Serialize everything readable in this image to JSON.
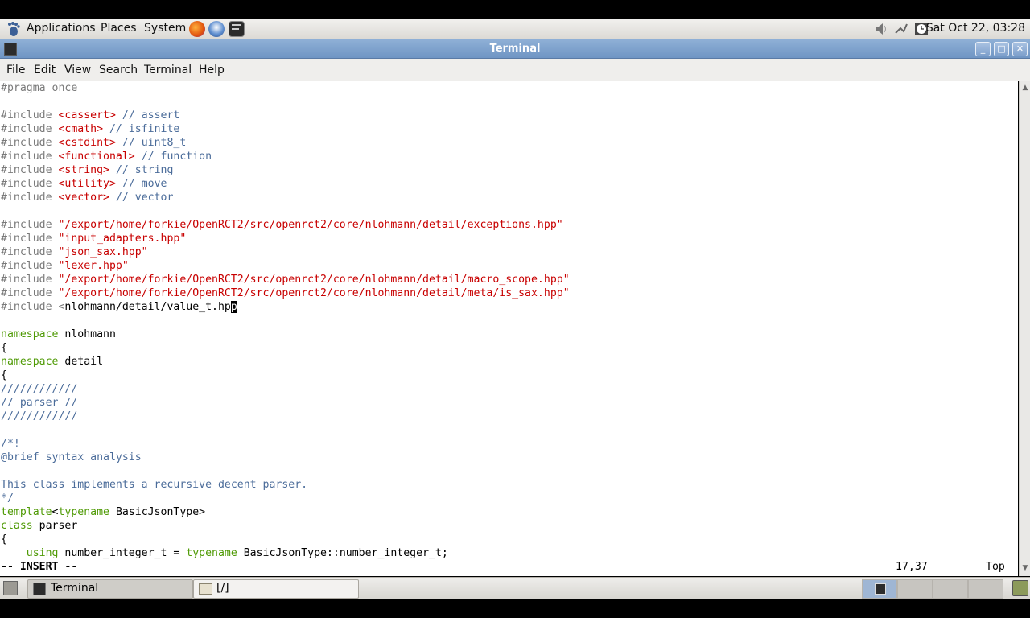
{
  "topbar": {
    "menus": [
      "Applications",
      "Places",
      "System"
    ],
    "clock": "Sat Oct 22, 03:28",
    "icons": [
      "gnome-foot-icon",
      "firefox-icon",
      "thunderbird-icon",
      "terminal-launcher-icon",
      "volume-icon",
      "network-icon",
      "clock-icon"
    ]
  },
  "window": {
    "title": "Terminal"
  },
  "menu": {
    "items": [
      "File",
      "Edit",
      "View",
      "Search",
      "Terminal",
      "Help"
    ]
  },
  "editor": {
    "lines": [
      [
        [
          "c-pre",
          "#pragma once"
        ]
      ],
      [],
      [
        [
          "c-pre",
          "#include "
        ],
        [
          "c-str",
          "<cassert>"
        ],
        [
          "c-com",
          " // assert"
        ]
      ],
      [
        [
          "c-pre",
          "#include "
        ],
        [
          "c-str",
          "<cmath>"
        ],
        [
          "c-com",
          " // isfinite"
        ]
      ],
      [
        [
          "c-pre",
          "#include "
        ],
        [
          "c-str",
          "<cstdint>"
        ],
        [
          "c-com",
          " // uint8_t"
        ]
      ],
      [
        [
          "c-pre",
          "#include "
        ],
        [
          "c-str",
          "<functional>"
        ],
        [
          "c-com",
          " // function"
        ]
      ],
      [
        [
          "c-pre",
          "#include "
        ],
        [
          "c-str",
          "<string>"
        ],
        [
          "c-com",
          " // string"
        ]
      ],
      [
        [
          "c-pre",
          "#include "
        ],
        [
          "c-str",
          "<utility>"
        ],
        [
          "c-com",
          " // move"
        ]
      ],
      [
        [
          "c-pre",
          "#include "
        ],
        [
          "c-str",
          "<vector>"
        ],
        [
          "c-com",
          " // vector"
        ]
      ],
      [],
      [
        [
          "c-pre",
          "#include "
        ],
        [
          "c-str",
          "\"/export/home/forkie/OpenRCT2/src/openrct2/core/nlohmann/detail/exceptions.hpp\""
        ]
      ],
      [
        [
          "c-pre",
          "#include "
        ],
        [
          "c-str",
          "\"input_adapters.hpp\""
        ]
      ],
      [
        [
          "c-pre",
          "#include "
        ],
        [
          "c-str",
          "\"json_sax.hpp\""
        ]
      ],
      [
        [
          "c-pre",
          "#include "
        ],
        [
          "c-str",
          "\"lexer.hpp\""
        ]
      ],
      [
        [
          "c-pre",
          "#include "
        ],
        [
          "c-str",
          "\"/export/home/forkie/OpenRCT2/src/openrct2/core/nlohmann/detail/macro_scope.hpp\""
        ]
      ],
      [
        [
          "c-pre",
          "#include "
        ],
        [
          "c-str",
          "\"/export/home/forkie/OpenRCT2/src/openrct2/core/nlohmann/detail/meta/is_sax.hpp\""
        ]
      ],
      [
        [
          "c-pre",
          "#include <"
        ],
        [
          "",
          "nlohmann/detail/value_t.hp"
        ],
        [
          "cursor",
          "p"
        ]
      ],
      [],
      [
        [
          "c-kw",
          "namespace"
        ],
        [
          "",
          " nlohmann"
        ]
      ],
      [
        [
          "",
          "{"
        ]
      ],
      [
        [
          "c-kw",
          "namespace"
        ],
        [
          "",
          " detail"
        ]
      ],
      [
        [
          "",
          "{"
        ]
      ],
      [
        [
          "c-com",
          "////////////"
        ]
      ],
      [
        [
          "c-com",
          "// parser //"
        ]
      ],
      [
        [
          "c-com",
          "////////////"
        ]
      ],
      [],
      [
        [
          "c-com",
          "/*!"
        ]
      ],
      [
        [
          "c-com",
          "@brief syntax analysis"
        ]
      ],
      [],
      [
        [
          "c-com",
          "This class implements a recursive decent parser."
        ]
      ],
      [
        [
          "c-com",
          "*/"
        ]
      ],
      [
        [
          "c-kw",
          "template"
        ],
        [
          "",
          "<"
        ],
        [
          "c-kw",
          "typename"
        ],
        [
          "",
          " BasicJsonType>"
        ]
      ],
      [
        [
          "c-kw",
          "class"
        ],
        [
          "",
          " parser"
        ]
      ],
      [
        [
          "",
          "{"
        ]
      ],
      [
        [
          "",
          "    "
        ],
        [
          "c-kw",
          "using"
        ],
        [
          "",
          " number_integer_t = "
        ],
        [
          "c-kw",
          "typename"
        ],
        [
          "",
          " BasicJsonType::number_integer_t;"
        ]
      ]
    ]
  },
  "status": {
    "mode": "-- INSERT --",
    "position": "17,37",
    "scroll": "Top"
  },
  "taskbar": {
    "items": [
      "Terminal",
      "[/]"
    ]
  }
}
